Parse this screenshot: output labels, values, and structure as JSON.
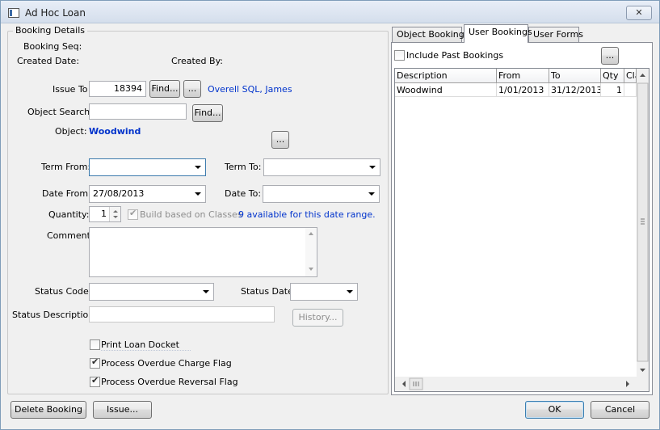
{
  "window": {
    "title": "Ad Hoc Loan",
    "close_glyph": "✕"
  },
  "group": {
    "title": "Booking Details"
  },
  "fields": {
    "booking_seq_label": "Booking Seq:",
    "created_date_label": "Created Date:",
    "created_by_label": "Created By:",
    "issue_to_label": "Issue To",
    "issue_to_value": "18394",
    "issue_to_find": "Find...",
    "issue_to_ellipsis": "...",
    "issue_to_name": "Overell SQL, James",
    "object_search_label": "Object Search:",
    "object_search_value": "",
    "object_search_find": "Find...",
    "object_label": "Object:",
    "object_value": "Woodwind",
    "object_ellipsis": "...",
    "term_from_label": "Term From:",
    "term_from_value": "",
    "term_to_label": "Term To:",
    "term_to_value": "",
    "date_from_label": "Date From:",
    "date_from_value": "27/08/2013",
    "date_to_label": "Date To:",
    "date_to_value": "",
    "quantity_label": "Quantity:",
    "quantity_value": "1",
    "build_classes_label": "Build based on Classes",
    "availability_text": "9 available for this date range.",
    "comment_label": "Comment:",
    "comment_value": "",
    "status_code_label": "Status Code:",
    "status_code_value": "",
    "status_date_label": "Status Date:",
    "status_date_value": "",
    "status_desc_label": "Status Description:",
    "status_desc_value": "",
    "history_button": "History...",
    "print_docket_label": "Print Loan Docket",
    "charge_flag_label": "Process Overdue Charge Flag",
    "reversal_flag_label": "Process Overdue Reversal Flag"
  },
  "checks": {
    "build_classes": true,
    "print_docket": false,
    "charge_flag": true,
    "reversal_flag": true,
    "include_past": false
  },
  "tabs": [
    {
      "label": "Object Bookings"
    },
    {
      "label": "User Bookings"
    },
    {
      "label": "User Forms"
    }
  ],
  "bookings": {
    "include_past_label": "Include Past Bookings",
    "ellipsis": "...",
    "columns": [
      "Description",
      "From",
      "To",
      "Qty",
      "Cla"
    ],
    "rows": [
      {
        "description": "Woodwind",
        "from": "1/01/2013",
        "to": "31/12/2013",
        "qty": "1",
        "cla": ""
      }
    ]
  },
  "footer": {
    "delete_button": "Delete Booking",
    "issue_button": "Issue...",
    "ok_button": "OK",
    "cancel_button": "Cancel"
  }
}
